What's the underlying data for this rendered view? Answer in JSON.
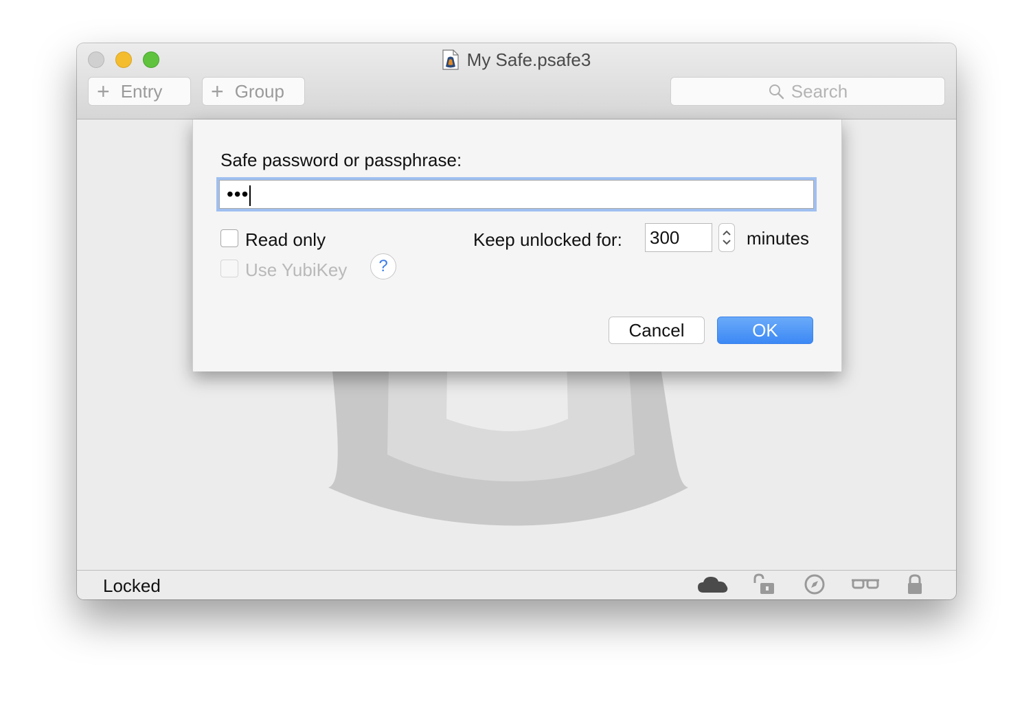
{
  "window": {
    "title": "My Safe.psafe3"
  },
  "toolbar": {
    "entry_label": "Entry",
    "group_label": "Group",
    "search_placeholder": "Search"
  },
  "dialog": {
    "password_label": "Safe password or passphrase:",
    "password_value": "•••",
    "read_only_label": "Read only",
    "read_only_checked": false,
    "yubikey_label": "Use YubiKey",
    "yubikey_enabled": false,
    "help_label": "?",
    "keep_unlocked_label": "Keep unlocked for:",
    "keep_unlocked_value": "300",
    "minutes_label": "minutes",
    "cancel_label": "Cancel",
    "ok_label": "OK"
  },
  "status": {
    "text": "Locked",
    "icons": [
      "cloud-icon",
      "unlock-icon",
      "compass-icon",
      "glasses-icon",
      "lock-icon"
    ]
  },
  "colors": {
    "accent": "#3c89f5",
    "focus_ring": "#9fbff0"
  }
}
